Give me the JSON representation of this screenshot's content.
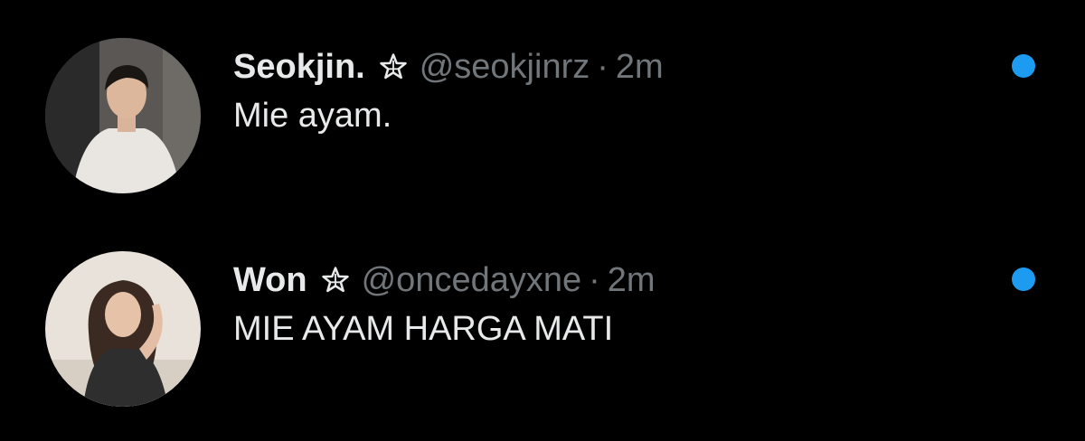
{
  "colors": {
    "background": "#000000",
    "primary_text": "#e7e9ea",
    "secondary_text": "#71767b",
    "unread_indicator": "#1d9bf0"
  },
  "tweets": [
    {
      "display_name": "Seokjin.",
      "name_icon": "star-outline-icon",
      "handle": "@seokjinrz",
      "separator": "·",
      "timestamp": "2m",
      "text": "Mie ayam.",
      "unread": true
    },
    {
      "display_name": "Won",
      "name_icon": "star-outline-icon",
      "handle": "@oncedayxne",
      "separator": "·",
      "timestamp": "2m",
      "text": "MIE AYAM HARGA MATI",
      "unread": true
    }
  ]
}
